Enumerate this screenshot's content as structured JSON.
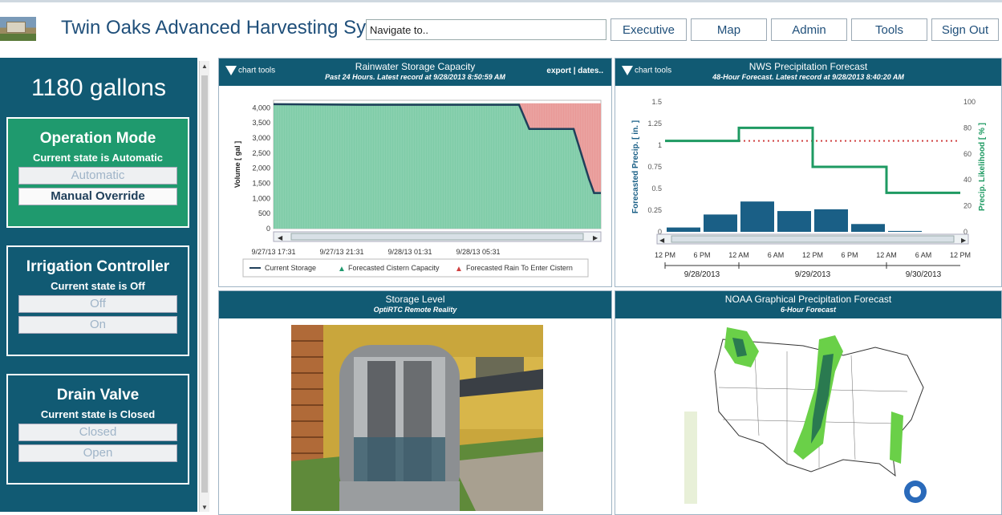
{
  "header": {
    "app_title": "Twin Oaks Advanced Harvesting Sy",
    "nav_placeholder": "Navigate to..",
    "nav_buttons": [
      "Executive",
      "Map",
      "Admin",
      "Tools",
      "Sign Out"
    ]
  },
  "sidebar": {
    "gallons": "1180 gallons",
    "controls": [
      {
        "title": "Operation Mode",
        "state": "Current state is Automatic",
        "btn1": "Automatic",
        "btn2": "Manual Override",
        "active": "green"
      },
      {
        "title": "Irrigation Controller",
        "state": "Current state is Off",
        "btn1": "Off",
        "btn2": "On"
      },
      {
        "title": "Drain Valve",
        "state": "Current state is Closed",
        "btn1": "Closed",
        "btn2": "Open"
      }
    ]
  },
  "panels": {
    "chart_tools": "chart tools",
    "rain": {
      "title": "Rainwater Storage Capacity",
      "subtitle": "Past 24 Hours. Latest record at 9/28/2013 8:50:59 AM",
      "export": "export | dates.."
    },
    "nws": {
      "title": "NWS Precipitation Forecast",
      "subtitle": "48-Hour Forecast. Latest record at 9/28/2013 8:40:20 AM"
    },
    "storage": {
      "title": "Storage Level",
      "subtitle": "OptiRTC Remote Reality"
    },
    "noaa": {
      "title": "NOAA Graphical Precipitation Forecast",
      "subtitle": "6-Hour Forecast"
    }
  },
  "colors": {
    "brand": "#115a73",
    "operation_active": "#1f9a6e",
    "storage_fill": "#7fcca8",
    "rain_fill": "#e99a98",
    "line": "#1f3f5a",
    "nws_bar": "#1a5f86",
    "nws_line": "#1e9a62"
  },
  "chart_data": [
    {
      "type": "area",
      "ylabel": "Volume [ gal ]",
      "ylim": [
        0,
        4250
      ],
      "y_ticks": [
        "4,000",
        "3,500",
        "3,000",
        "2,500",
        "2,000",
        "1,500",
        "1,000",
        "500",
        "0"
      ],
      "x_ticks": [
        "9/27/13 17:31",
        "9/27/13 21:31",
        "9/28/13 01:31",
        "9/28/13 05:31"
      ],
      "series": [
        {
          "name": "Current Storage",
          "points": [
            [
              0,
              4120
            ],
            [
              5,
              4100
            ],
            [
              12,
              4100
            ],
            [
              14.4,
              4100
            ],
            [
              15.0,
              3300
            ],
            [
              17.6,
              3300
            ],
            [
              18.5,
              1650
            ],
            [
              18.8,
              1180
            ],
            [
              19.2,
              1180
            ]
          ]
        },
        {
          "name": "Forecasted Cistern Capacity",
          "points": [
            [
              0,
              4150
            ],
            [
              14.4,
              4150
            ],
            [
              15.0,
              3330
            ],
            [
              17.6,
              3330
            ],
            [
              18.5,
              1650
            ],
            [
              18.8,
              1220
            ],
            [
              19.2,
              1220
            ]
          ]
        },
        {
          "name": "Forecasted Rain To Enter Cistern",
          "points": [
            [
              14.4,
              4150
            ],
            [
              19.2,
              4150
            ]
          ]
        }
      ],
      "x_domain": [
        0,
        19.2
      ],
      "legend": "bottom"
    },
    {
      "type": "bar",
      "ylabel_left": "Forecasted Precip. [ in. ]",
      "ylabel_right": "Precip. Likelihood [ % ]",
      "y_left_ticks": [
        "1.5",
        "1.25",
        "1",
        "0.75",
        "0.5",
        "0.25",
        "0"
      ],
      "y_right_ticks": [
        "100",
        "80",
        "60",
        "40",
        "20",
        "0"
      ],
      "ylim_left": [
        0,
        1.5
      ],
      "ylim_right": [
        0,
        100
      ],
      "x_ticks": [
        "12 PM",
        "6 PM",
        "12 AM",
        "6 AM",
        "12 PM",
        "6 PM",
        "12 AM",
        "6 AM",
        "12 PM"
      ],
      "date_labels": [
        "9/28/2013",
        "9/29/2013",
        "9/30/2013"
      ],
      "bars": [
        0.05,
        0.2,
        0.35,
        0.24,
        0.26,
        0.09,
        0.01
      ],
      "likelihood_steps": [
        [
          0,
          70
        ],
        [
          2,
          80
        ],
        [
          4,
          50
        ],
        [
          6,
          30
        ],
        [
          8,
          30
        ]
      ],
      "likelihood_dotted_value": 70
    }
  ]
}
